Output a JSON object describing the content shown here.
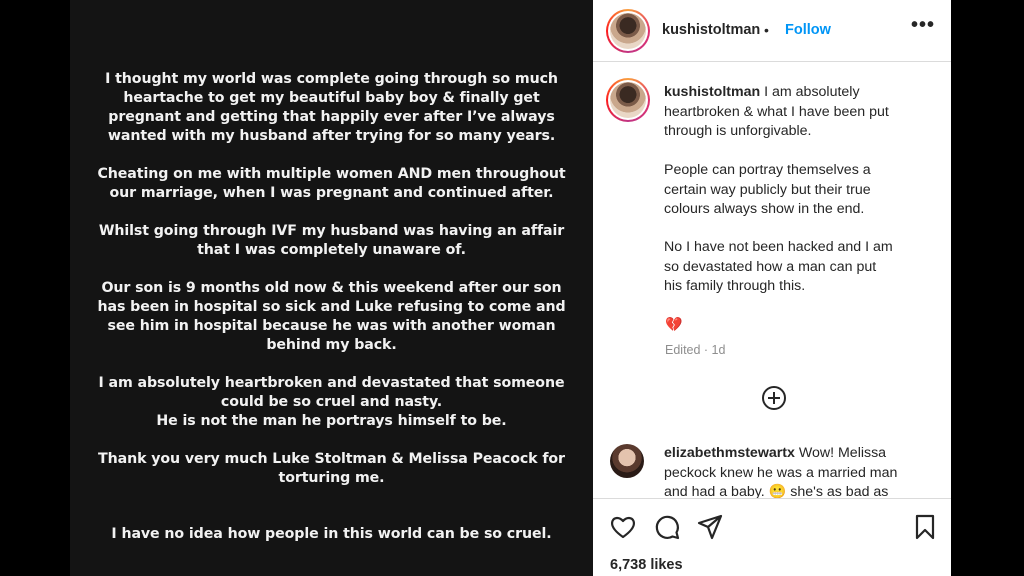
{
  "story": {
    "paragraphs": [
      "I thought my world was complete going through so much\nheartache to get my beautiful baby boy & finally get\npregnant and  getting that happily ever after I’ve always\nwanted with my husband after trying for so many years.",
      "Cheating on me with multiple women AND men throughout\nour marriage, when I was pregnant and continued after.",
      "Whilst going through IVF my husband was having an affair\nthat I was completely unaware of.",
      "Our son is 9 months old now & this weekend after our son\nhas been in hospital so sick and Luke refusing to come and\nsee him in hospital because he was with another woman\nbehind my back.",
      "I am absolutely heartbroken and devastated that someone\ncould be so cruel and nasty.\nHe is not the man he portrays himself to be.",
      "Thank you very much Luke Stoltman & Melissa Peacock for\ntorturing me.",
      "I have no idea how people in this world can be so cruel."
    ]
  },
  "post": {
    "header": {
      "username": "kushistoltman",
      "separator": "•",
      "follow_label": "Follow",
      "more_icon": "more-options-icon"
    },
    "caption": {
      "username": "kushistoltman",
      "text_first": " I am absolutely\nheartbroken & what I have been put\nthrough is unforgivable.",
      "para2": "People can portray themselves a\ncertain way publicly but their true\ncolours always show in the end.",
      "para3": "No I have not been hacked and I am\nso devastated how a man can put\nhis family through this.",
      "emoji": "💔",
      "edited": "Edited · 1d"
    },
    "reply": {
      "username": "elizabethmstewartx",
      "text": " Wow! Melissa\npeckock knew he was a married man\nand had a baby. 😬 she's as bad as"
    },
    "likes": "6,738 likes"
  },
  "colors": {
    "story_bg": "#141414",
    "accent_blue": "#0095f6",
    "text_dark": "#262626",
    "muted": "#8e8e8e"
  }
}
